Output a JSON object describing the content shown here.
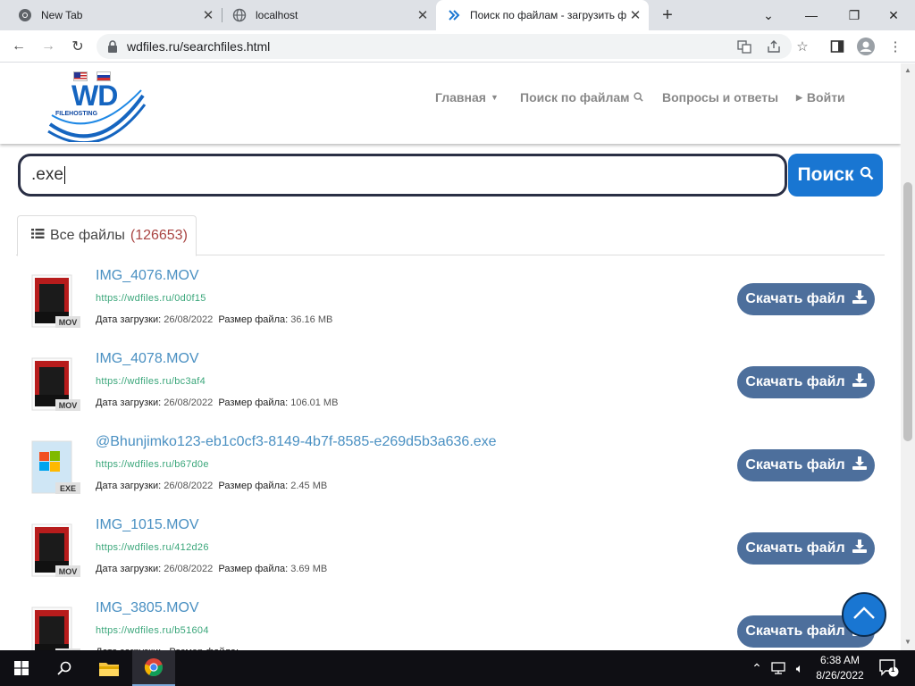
{
  "browser": {
    "tabs": [
      {
        "title": "New Tab"
      },
      {
        "title": "localhost"
      },
      {
        "title": "Поиск по файлам - загрузить ф"
      }
    ],
    "url": "wdfiles.ru/searchfiles.html"
  },
  "site": {
    "logo_text": "WD",
    "logo_sub": "FILEHOSTING",
    "nav": {
      "home": "Главная",
      "search": "Поиск по файлам",
      "faq": "Вопросы и ответы",
      "login": "Войти"
    }
  },
  "search": {
    "query": ".exe",
    "button_label": "Поиск"
  },
  "results": {
    "tab_label": "Все файлы",
    "tab_count": "(126653)",
    "date_label": "Дата загрузки:",
    "size_label": "Размер файла:",
    "download_label": "Скачать файл",
    "files": [
      {
        "name": "IMG_4076.MOV",
        "link": "https://wdfiles.ru/0d0f15",
        "date": "26/08/2022",
        "size": "36.16 MB",
        "type": "MOV"
      },
      {
        "name": "IMG_4078.MOV",
        "link": "https://wdfiles.ru/bc3af4",
        "date": "26/08/2022",
        "size": "106.01 MB",
        "type": "MOV"
      },
      {
        "name": "@Bhunjimko123-eb1c0cf3-8149-4b7f-8585-e269d5b3a636.exe",
        "link": "https://wdfiles.ru/b67d0e",
        "date": "26/08/2022",
        "size": "2.45 MB",
        "type": "EXE"
      },
      {
        "name": "IMG_1015.MOV",
        "link": "https://wdfiles.ru/412d26",
        "date": "26/08/2022",
        "size": "3.69 MB",
        "type": "MOV"
      },
      {
        "name": "IMG_3805.MOV",
        "link": "https://wdfiles.ru/b51604",
        "date": "",
        "size": "",
        "type": "MOV"
      }
    ]
  },
  "taskbar": {
    "time": "6:38 AM",
    "date": "8/26/2022",
    "notification_count": "1"
  },
  "colors": {
    "accent": "#1976d2",
    "download_button": "#4d6f9c",
    "file_name": "#4a90c2",
    "file_link": "#3aa67a",
    "count": "#a94442"
  }
}
